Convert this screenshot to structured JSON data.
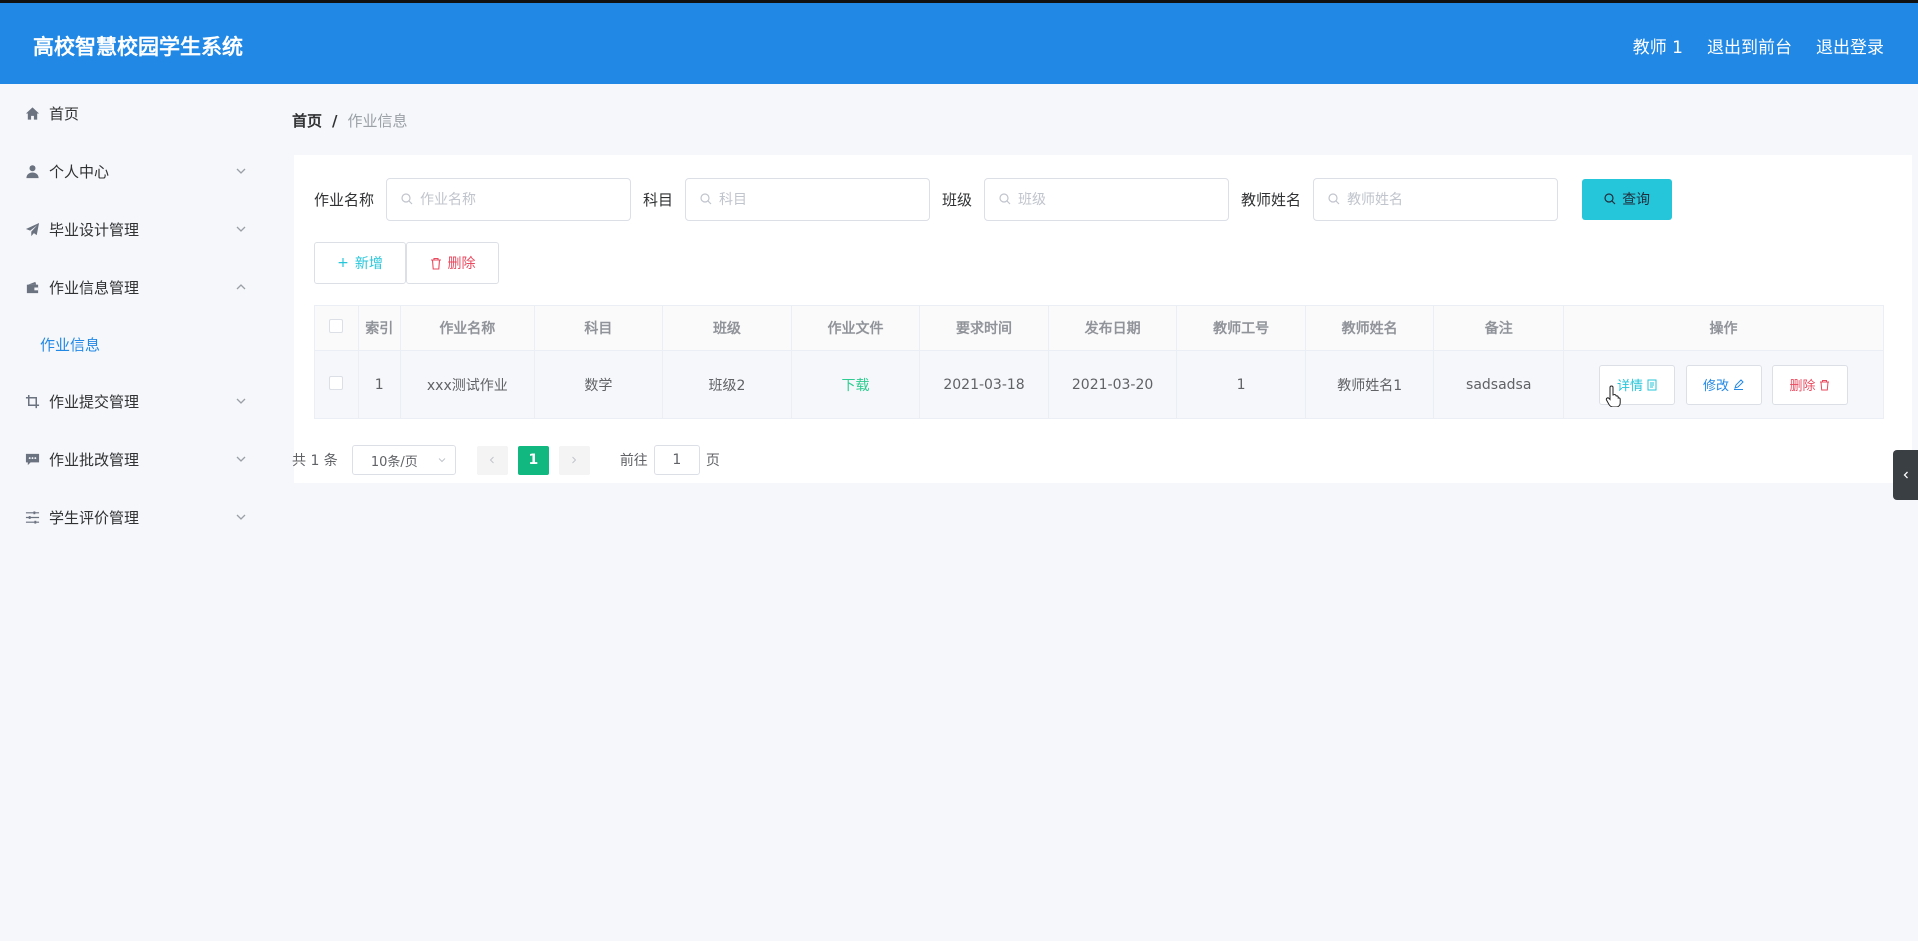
{
  "header": {
    "title": "高校智慧校园学生系统",
    "user": "教师 1",
    "exit_front": "退出到前台",
    "logout": "退出登录"
  },
  "sidebar": {
    "items": [
      {
        "label": "首页",
        "icon": "home-icon"
      },
      {
        "label": "个人中心",
        "icon": "user-icon"
      },
      {
        "label": "毕业设计管理",
        "icon": "send-icon"
      },
      {
        "label": "作业信息管理",
        "icon": "wallet-icon",
        "expanded": true,
        "children": [
          "作业信息"
        ]
      },
      {
        "label": "作业提交管理",
        "icon": "crop-icon"
      },
      {
        "label": "作业批改管理",
        "icon": "comment-icon"
      },
      {
        "label": "学生评价管理",
        "icon": "sliders-icon"
      }
    ]
  },
  "breadcrumb": {
    "home": "首页",
    "sep": "/",
    "current": "作业信息"
  },
  "search": {
    "fields": [
      {
        "label": "作业名称",
        "placeholder": "作业名称"
      },
      {
        "label": "科目",
        "placeholder": "科目"
      },
      {
        "label": "班级",
        "placeholder": "班级"
      },
      {
        "label": "教师姓名",
        "placeholder": "教师姓名"
      }
    ],
    "query_label": "查询"
  },
  "actions": {
    "add_label": "新增",
    "delete_label": "删除"
  },
  "table": {
    "columns": [
      "索引",
      "作业名称",
      "科目",
      "班级",
      "作业文件",
      "要求时间",
      "发布日期",
      "教师工号",
      "教师姓名",
      "备注",
      "操作"
    ],
    "rows": [
      {
        "index": "1",
        "name": "xxx测试作业",
        "subject": "数学",
        "class": "班级2",
        "file": "下载",
        "required": "2021-03-18",
        "published": "2021-03-20",
        "teacher_no": "1",
        "teacher_name": "教师姓名1",
        "remark": "sadsadsa"
      }
    ],
    "op_labels": {
      "detail": "详情",
      "edit": "修改",
      "remove": "删除"
    }
  },
  "pagination": {
    "total_text": "共 1 条",
    "page_size": "10条/页",
    "current_page": "1",
    "goto_label": "前往",
    "goto_value": "1",
    "page_suffix": "页"
  },
  "colors": {
    "primary": "#2188e6",
    "query_btn": "#26c6da",
    "active_page": "#11b981",
    "danger": "#e84a5f",
    "link_green": "#2ecc91"
  }
}
